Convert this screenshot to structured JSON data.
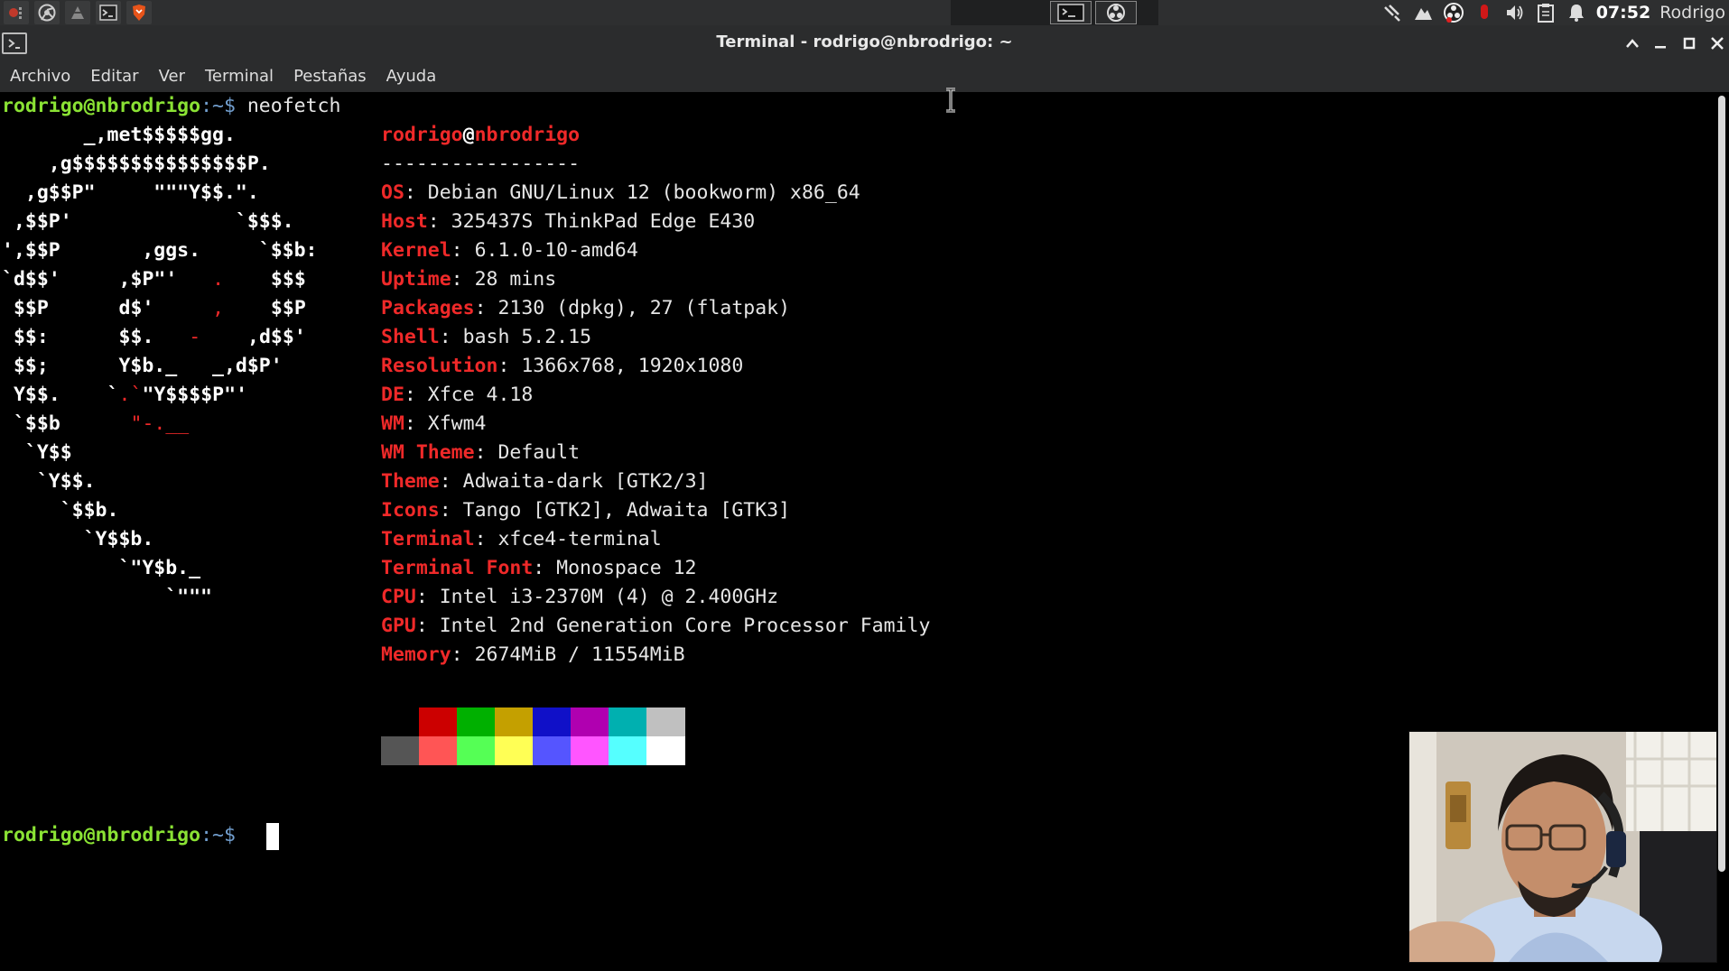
{
  "panel": {
    "launcher_icons": [
      "app-menu-icon",
      "chromium-icon",
      "inkscape-icon",
      "terminal-icon",
      "brave-icon"
    ],
    "task_icons": [
      "terminal-task-icon",
      "obs-task-icon"
    ],
    "tray_icons": [
      "network-icon",
      "mountain-icon",
      "obs-tray-icon",
      "record-icon",
      "volume-icon",
      "clipboard-icon",
      "bell-icon"
    ],
    "clock": "07:52",
    "user": "Rodrigo"
  },
  "window": {
    "title": "Terminal - rodrigo@nbrodrigo: ~",
    "menu": [
      "Archivo",
      "Editar",
      "Ver",
      "Terminal",
      "Pestañas",
      "Ayuda"
    ]
  },
  "terminal": {
    "prompt_user": "rodrigo@nbrodrigo",
    "prompt_sep": ":~$",
    "command": "neofetch",
    "header_user": "rodrigo",
    "header_at": "@",
    "header_host": "nbrodrigo",
    "separator": "-----------------",
    "ascii_art": [
      "       _,met$$$$$gg.",
      "    ,g$$$$$$$$$$$$$$$P.",
      "  ,g$$P\"     \"\"\"Y$$.\".",
      " ,$$P'              `$$$.",
      "',$$P       ,ggs.     `$$b:",
      "`d$$'     ,$P\"'   .    $$$",
      " $$P      d$'     ,    $$P",
      " $$:      $$.   -    ,d$$'",
      " $$;      Y$b._   _,d$P'",
      " Y$$.    `.`\"Y$$$$P\"'",
      " `$$b      \"-.__",
      "  `Y$$",
      "   `Y$$.",
      "     `$$b.",
      "       `Y$$b.",
      "          `\"Y$b._",
      "              `\"\"\""
    ],
    "info": [
      {
        "key": "OS",
        "value": "Debian GNU/Linux 12 (bookworm) x86_64"
      },
      {
        "key": "Host",
        "value": "325437S ThinkPad Edge E430"
      },
      {
        "key": "Kernel",
        "value": "6.1.0-10-amd64"
      },
      {
        "key": "Uptime",
        "value": "28 mins"
      },
      {
        "key": "Packages",
        "value": "2130 (dpkg), 27 (flatpak)"
      },
      {
        "key": "Shell",
        "value": "bash 5.2.15"
      },
      {
        "key": "Resolution",
        "value": "1366x768, 1920x1080"
      },
      {
        "key": "DE",
        "value": "Xfce 4.18"
      },
      {
        "key": "WM",
        "value": "Xfwm4"
      },
      {
        "key": "WM Theme",
        "value": "Default"
      },
      {
        "key": "Theme",
        "value": "Adwaita-dark [GTK2/3]"
      },
      {
        "key": "Icons",
        "value": "Tango [GTK2], Adwaita [GTK3]"
      },
      {
        "key": "Terminal",
        "value": "xfce4-terminal"
      },
      {
        "key": "Terminal Font",
        "value": "Monospace 12"
      },
      {
        "key": "CPU",
        "value": "Intel i3-2370M (4) @ 2.400GHz"
      },
      {
        "key": "GPU",
        "value": "Intel 2nd Generation Core Processor Family"
      },
      {
        "key": "Memory",
        "value": "2674MiB / 11554MiB"
      }
    ],
    "palette_row1": [
      "#000000",
      "#cc0000",
      "#00b000",
      "#c4a000",
      "#1010c8",
      "#b000b0",
      "#00b0b0",
      "#c0c0c0"
    ],
    "palette_row2": [
      "#555555",
      "#ff5555",
      "#55ff55",
      "#ffff55",
      "#5555ff",
      "#ff55ff",
      "#55ffff",
      "#ffffff"
    ]
  },
  "colors": {
    "prompt_green": "#8ae234",
    "path_blue": "#729fcf",
    "accent_red": "#ef2929"
  },
  "webcam": {
    "subject": "person-with-headset"
  }
}
